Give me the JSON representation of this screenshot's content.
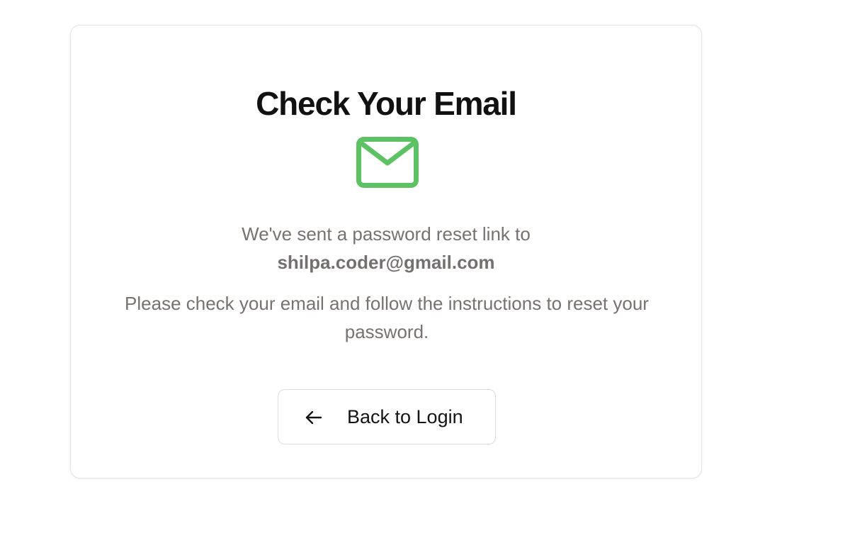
{
  "page": {
    "title": "Check Your Email",
    "icon": "mail-icon",
    "accent_color": "#5dc264"
  },
  "message": {
    "sent_text": "We've sent a password reset link to",
    "email": "shilpa.coder@gmail.com",
    "instructions": "Please check your email and follow the instructions to reset your password."
  },
  "actions": {
    "back_label": "Back to Login",
    "back_icon": "arrow-left-icon"
  }
}
